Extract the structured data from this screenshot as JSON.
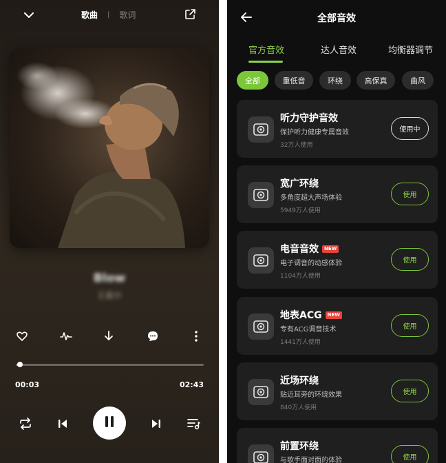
{
  "player": {
    "tabs": {
      "song": "歌曲",
      "separator": "|",
      "lyrics": "歌词"
    },
    "song_title": "Blow",
    "artist": "王嘉尔",
    "progress": {
      "current": "00:03",
      "total": "02:43",
      "fraction": 0.019
    },
    "icons": {
      "collapse": "chevron-down-icon",
      "share": "share-icon",
      "like": "heart-icon",
      "sound_effect": "waveform-icon",
      "download": "download-icon",
      "comment": "comment-icon",
      "more": "more-vertical-icon",
      "repeat": "repeat-icon",
      "previous": "skip-previous-icon",
      "pause": "pause-icon",
      "next": "skip-next-icon",
      "playlist": "playlist-icon"
    }
  },
  "effects": {
    "title": "全部音效",
    "tabs": [
      "官方音效",
      "达人音效",
      "均衡器调节"
    ],
    "active_tab": 0,
    "chips": [
      "全部",
      "重低音",
      "环绕",
      "高保真",
      "曲风"
    ],
    "active_chip": 0,
    "accent_color": "#8ed34a",
    "items": [
      {
        "name": "听力守护音效",
        "desc": "保护听力健康专属音效",
        "users": "32万人使用",
        "button": "使用中",
        "badge": ""
      },
      {
        "name": "宽广环绕",
        "desc": "多角度超大声场体验",
        "users": "5949万人使用",
        "button": "使用",
        "badge": ""
      },
      {
        "name": "电音音效",
        "desc": "电子调音的动感体验",
        "users": "1104万人使用",
        "button": "使用",
        "badge": "NEW"
      },
      {
        "name": "地表ACG",
        "desc": "专有ACG调音技术",
        "users": "1441万人使用",
        "button": "使用",
        "badge": "NEW"
      },
      {
        "name": "近场环绕",
        "desc": "贴近耳旁的环绕效果",
        "users": "840万人使用",
        "button": "使用",
        "badge": ""
      },
      {
        "name": "前置环绕",
        "desc": "与歌手面对面的体验",
        "users": "",
        "button": "使用",
        "badge": ""
      }
    ]
  }
}
